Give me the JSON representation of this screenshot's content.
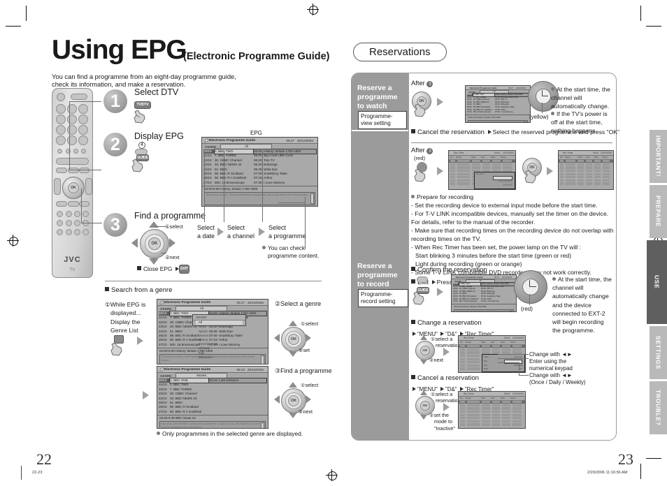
{
  "document": {
    "left_page_number": "22",
    "right_page_number": "23",
    "footer_left": "22-23",
    "footer_right": "2/20/2006  11:16:56 AM"
  },
  "left": {
    "title": "Using EPG",
    "title_suffix": "(Electronic Programme Guide)",
    "intro_line1": "You can find a programme from an eight-day programme guide,",
    "intro_line2": "check its information, and make a reservation.",
    "remote_brand": "JVC",
    "remote_model": "TV",
    "steps": [
      {
        "num": "1",
        "label": "Select DTV",
        "key": "TV/DTV"
      },
      {
        "num": "2",
        "label": "Display EPG",
        "key": "GUIDE",
        "key_badge": "4"
      },
      {
        "num": "3",
        "label": "Find a programme",
        "dpad_1": "select",
        "dpad_2": "next"
      }
    ],
    "close_epg_label": "Close EPG",
    "close_epg_key": "EXIT",
    "epg_caption": "EPG",
    "pointer_labels": {
      "a_line1": "Select",
      "a_line2": "a date",
      "b_line1": "Select",
      "b_line2": "a channel",
      "c_line1": "Select",
      "c_line2": "a programme",
      "d_line1": "You can check",
      "d_line2": "programme content."
    },
    "genre_section": {
      "heading": "Search from a genre",
      "step1_line1": "While EPG is",
      "step1_line2": "displayed...",
      "step1_line3": "Display the",
      "step1_line4": "Genre List",
      "step2": "Select a genre",
      "step2_d1": "select",
      "step2_d2": "set",
      "step3": "Find a programme",
      "step3_d1": "select",
      "step3_d2": "next",
      "note": "Only programmes in the selected genre are displayed.",
      "genre_header": "GENRE",
      "genres": [
        "All",
        "News",
        "Sports",
        "Movies",
        "Drama",
        "Entertainment",
        "Lifestyle",
        "Kids",
        "Education"
      ],
      "selected_genre": "All"
    },
    "epg_screen_1": {
      "window_title": "Electronic Programme Guide",
      "time": "05:27",
      "date": "20/10/2004",
      "genre_label": "GENRE",
      "genre_value": "All",
      "rows": [
        {
          "date": "20/10",
          "channel": "2. BBC TWO",
          "programme": "04:00- History: Britain 1750-1900",
          "selected": true
        },
        {
          "date": "21/10",
          "channel": "7. BBC THREE",
          "programme": "06:00- Big Cook Little Cook",
          "selected": false
        },
        {
          "date": "22/10",
          "channel": "30. CBBC Channel",
          "programme": "06:20- Tots TV",
          "selected": false
        },
        {
          "date": "23/10",
          "channel": "40. BBC NEWS 24",
          "programme": "06:30- Bobinoga",
          "selected": false
        },
        {
          "date": "24/10",
          "channel": "51. BBCi",
          "programme": "06:45- Wide Eye",
          "selected": false
        },
        {
          "date": "25/10",
          "channel": "89. BBC R Scotland",
          "programme": "07:00- Snailsbury Tales",
          "selected": false
        },
        {
          "date": "26/10",
          "channel": "90. BBC R n Gaidheal",
          "programme": "07:15- Arthur",
          "selected": false
        },
        {
          "date": "27/10",
          "channel": "800. 16:9monoscope",
          "programme": "07:30- I Love Mummy",
          "selected": false
        }
      ],
      "info_line": "04:00-6:00   History: Britain 1750-1900",
      "description": "Secondary schools. How industrialisation changed the day-to-day lives of the British people."
    },
    "epg_screen_2": {
      "window_title": "Electronic Programme Guide",
      "time": "05:27",
      "date": "20/10/2004",
      "genre_label": "GENRE",
      "genre_value": "All"
    },
    "epg_screen_3": {
      "window_title": "Electronic Programme Guide",
      "time": "05:43",
      "date": "20/10/2004",
      "genre_label": "GENRE",
      "genre_value": "Movies",
      "rows": [
        {
          "date": "20/10",
          "channel": "1. BBC ONE",
          "programme": "04:15- Last entrance",
          "selected": true
        },
        {
          "date": "21/10",
          "channel": "2. BBC TWO",
          "programme": "",
          "selected": false
        },
        {
          "date": "22/10",
          "channel": "7. BBC THREE",
          "programme": "",
          "selected": false
        },
        {
          "date": "23/10",
          "channel": "30. CBBC Channel",
          "programme": "",
          "selected": false
        },
        {
          "date": "24/10",
          "channel": "40. BBC NEWS 24",
          "programme": "",
          "selected": false
        },
        {
          "date": "25/10",
          "channel": "51. BBCi",
          "programme": "",
          "selected": false
        },
        {
          "date": "26/10",
          "channel": "89. BBC R Scotland",
          "programme": "",
          "selected": false
        },
        {
          "date": "27/10",
          "channel": "90. BBC R n Gaidheal",
          "programme": "",
          "selected": false
        }
      ],
      "info_line": "03:25-6:30   BBC News 24",
      "description": "Non-stop, joint the BBC's rolling news channel for a night of news, with bulletins on the hour and the headlines every 15 minutes."
    }
  },
  "right": {
    "section_title": "Reservations",
    "watch": {
      "side_title_l1": "Reserve a",
      "side_title_l2": "programme",
      "side_title_l3": "to watch",
      "tag_l1": "Programme-",
      "tag_l2": "view setting",
      "after_label": "After",
      "after_step": "3",
      "yellow_label": "(yellow)",
      "notes": [
        "At the start time, the channel will automatically change.",
        "If the TV's power is off at the start time, nothing happens."
      ],
      "cancel_heading": "Cancel the reservation",
      "cancel_detail": "Select the reserved programme and press \"OK\""
    },
    "record": {
      "after_label": "After",
      "after_step": "3",
      "red_label": "(red)",
      "prepare_heading": "Prepare for recording",
      "prepare_items": [
        "Set the recording device to external input mode before the start time.",
        "For T-V LINK incompatible devices, manually set the timer on the device. For details, refer to the manual of the recorder.",
        "Make sure that recording times on the recording device do not overlap with recording times on the TV.",
        "When Rec Timer has been set, the power lamp on the TV will :",
        "Start blinking 3 minutes before the start time (green or red)",
        "Light during recording (green or orange)",
        "Some T-V LINK compatible DVD recorders may not work correctly."
      ],
      "exit_heading": "Exit",
      "exit_detail": "Press \"MENU\"",
      "side_title_l1": "Reserve a",
      "side_title_l2": "programme",
      "side_title_l3": "to record",
      "tag_l1": "Programme-",
      "tag_l2": "record setting",
      "confirm_heading": "Confirm the reservation",
      "confirm_red_label": "(red)",
      "confirm_notes": [
        "At the start time, the channel will automatically change and the device connected to EXT-2 will begin recording the programme."
      ],
      "change_heading": "Change a reservation",
      "change_path_1": "\"MENU\"",
      "change_path_2": "\"D&\"",
      "change_path_3": "\"Rec Timer\"",
      "change_d1": "select a",
      "change_d1b": "reservation",
      "change_d2": "next",
      "callout_1": "Change with",
      "callout_2_l1": "Enter using the",
      "callout_2_l2": "numerical keypad",
      "callout_3_l1": "Change with",
      "callout_3_l2": "(Once / Daily / Weekly)",
      "cancel_heading": "Cancel a reservation",
      "cancel_path_1": "\"MENU\"",
      "cancel_path_2": "\"D&\"",
      "cancel_path_3": "\"Rec Timer\"",
      "cancel_d1": "select a",
      "cancel_d1b": "reservation",
      "cancel_d2_l1": "set the",
      "cancel_d2_l2": "mode to",
      "cancel_d2_l3": "\"Inactive\""
    },
    "rec_timer_screen": {
      "title": "Rec Timer",
      "time": "05:43",
      "date": "20/10/2004",
      "columns": [
        "No.",
        "Name",
        "Start",
        "End",
        "Date",
        "Mode"
      ]
    }
  },
  "tabs": [
    {
      "label": "IMPORTANT!",
      "active": false
    },
    {
      "label": "PREPARE",
      "active": false
    },
    {
      "label": "USE",
      "active": true
    },
    {
      "label": "SETTINGS",
      "active": false
    },
    {
      "label": "TROUBLE?",
      "active": false
    }
  ]
}
